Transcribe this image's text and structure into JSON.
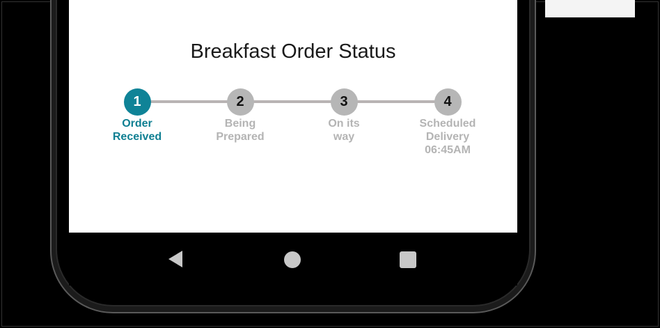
{
  "screen": {
    "title": "Breakfast Order Status",
    "steps": [
      {
        "number": "1",
        "label_line1": "Order",
        "label_line2": "Received",
        "label_line3": "",
        "state": "active"
      },
      {
        "number": "2",
        "label_line1": "Being",
        "label_line2": "Prepared",
        "label_line3": "",
        "state": "inactive"
      },
      {
        "number": "3",
        "label_line1": "On its",
        "label_line2": "way",
        "label_line3": "",
        "state": "inactive"
      },
      {
        "number": "4",
        "label_line1": "Scheduled",
        "label_line2": "Delivery",
        "label_line3": "06:45AM",
        "state": "inactive"
      }
    ]
  },
  "colors": {
    "active": "#0f8397",
    "inactive": "#b6b6b6",
    "track": "#b9b4b4"
  },
  "navigation": {
    "icons": [
      "back-triangle-icon",
      "home-circle-icon",
      "recent-square-icon"
    ]
  }
}
